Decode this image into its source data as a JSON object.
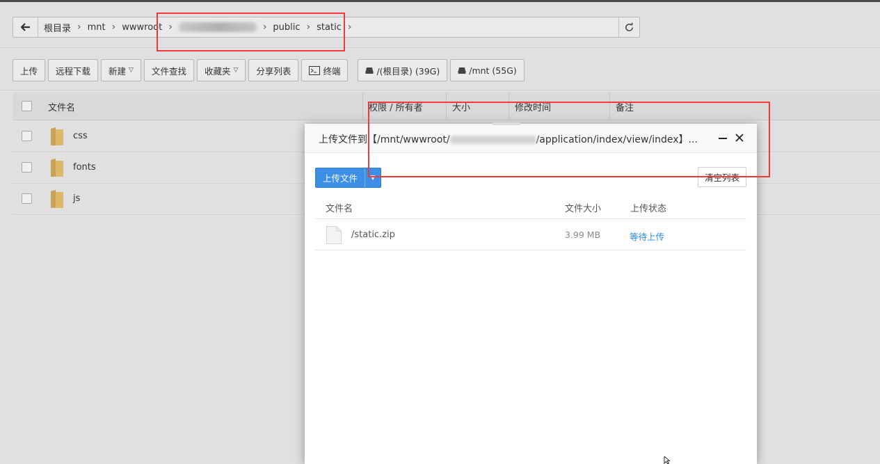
{
  "breadcrumb": {
    "items": [
      "根目录",
      "mnt",
      "wwwroot",
      "public",
      "static"
    ]
  },
  "toolbar": {
    "upload": "上传",
    "remote_download": "远程下载",
    "new": "新建",
    "file_search": "文件查找",
    "favorites": "收藏夹",
    "share_list": "分享列表",
    "terminal": "终端",
    "disk_root": "/(根目录) (39G)",
    "disk_mnt": "/mnt (55G)"
  },
  "table": {
    "headers": {
      "name": "文件名",
      "permission": "权限 / 所有者",
      "size": "大小",
      "modified": "修改时间",
      "note": "备注"
    },
    "rows": [
      {
        "name": "css"
      },
      {
        "name": "fonts"
      },
      {
        "name": "js"
      }
    ]
  },
  "dialog": {
    "title_prefix": "上传文件到【/mnt/wwwroot/",
    "title_suffix": "/application/index/view/index】...",
    "upload_button": "上传文件",
    "clear_button": "清空列表",
    "headers": {
      "name": "文件名",
      "size": "文件大小",
      "status": "上传状态"
    },
    "files": [
      {
        "name": "/static.zip",
        "size": "3.99 MB",
        "status": "等待上传"
      }
    ]
  },
  "colors": {
    "accent_blue": "#3d8fe6",
    "status_blue": "#2b8ce8",
    "annotation_red": "#f03a3a",
    "folder_yellow": "#dcb96a"
  }
}
